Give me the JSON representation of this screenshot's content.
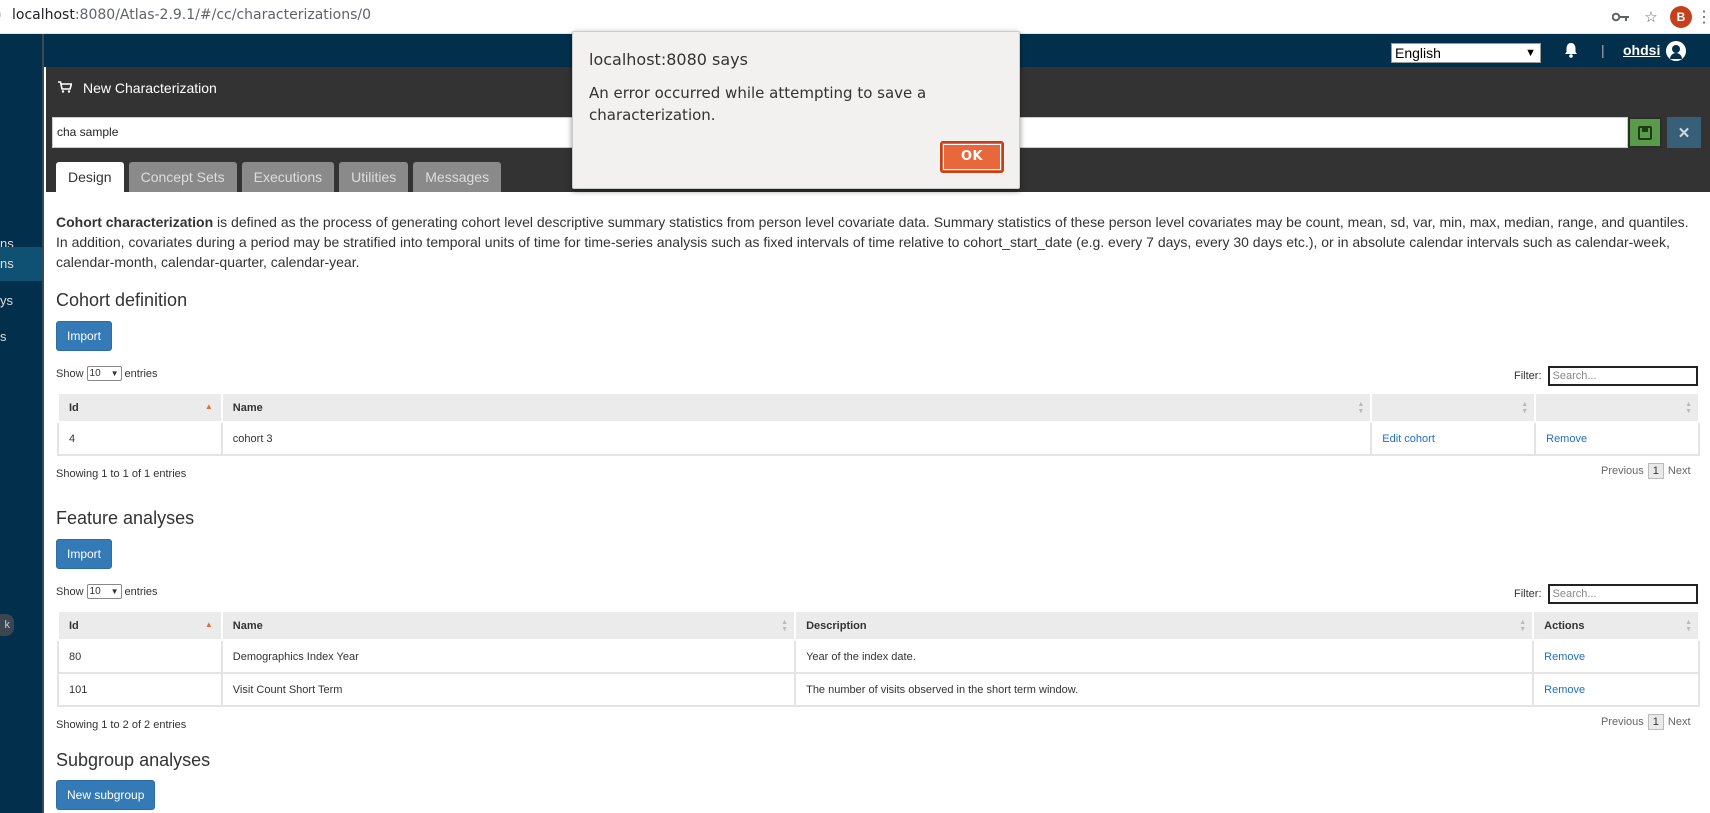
{
  "browser": {
    "url_host": "localhost",
    "url_rest": ":8080/Atlas-2.9.1/#/cc/characterizations/0",
    "profile_initial": "B",
    "icons": [
      "key-icon",
      "star-icon",
      "kebab-menu-icon"
    ]
  },
  "sidebar": {
    "items": [
      {
        "label": "ns",
        "active": false
      },
      {
        "label": "ns",
        "active": true
      },
      {
        "label": "ys",
        "active": false
      },
      {
        "label": "s",
        "active": false
      }
    ],
    "pill": "k"
  },
  "topbar": {
    "language": "English",
    "separator": "|",
    "user": "ohdsi"
  },
  "panel": {
    "title": "New Characterization",
    "name_value": "cha sample",
    "tabs": [
      "Design",
      "Concept Sets",
      "Executions",
      "Utilities",
      "Messages"
    ]
  },
  "description": {
    "bold": "Cohort characterization",
    "rest": " is defined as the process of generating cohort level descriptive summary statistics from person level covariate data. Summary statistics of these person level covariates may be count, mean, sd, var, min, max, median, range, and quantiles. In addition, covariates during a period may be stratified into temporal units of time for time-series analysis such as fixed intervals of time relative to cohort_start_date (e.g. every 7 days, every 30 days etc.), or in absolute calendar intervals such as calendar-week, calendar-month, calendar-quarter, calendar-year."
  },
  "cohort_section": {
    "title": "Cohort definition",
    "import_label": "Import",
    "show_label": "Show",
    "entries_value": "10",
    "entries_label": "entries",
    "filter_label": "Filter:",
    "filter_placeholder": "Search...",
    "columns": [
      "Id",
      "Name",
      "",
      ""
    ],
    "rows": [
      {
        "id": "4",
        "name": "cohort 3",
        "edit": "Edit cohort",
        "remove": "Remove"
      }
    ],
    "showing": "Showing 1 to 1 of 1 entries",
    "prev": "Previous",
    "page": "1",
    "next": "Next"
  },
  "feature_section": {
    "title": "Feature analyses",
    "import_label": "Import",
    "show_label": "Show",
    "entries_value": "10",
    "entries_label": "entries",
    "filter_label": "Filter:",
    "filter_placeholder": "Search...",
    "columns": [
      "Id",
      "Name",
      "Description",
      "Actions"
    ],
    "rows": [
      {
        "id": "80",
        "name": "Demographics Index Year",
        "description": "Year of the index date.",
        "action": "Remove"
      },
      {
        "id": "101",
        "name": "Visit Count Short Term",
        "description": "The number of visits observed in the short term window.",
        "action": "Remove"
      }
    ],
    "showing": "Showing 1 to 2 of 2 entries",
    "prev": "Previous",
    "page": "1",
    "next": "Next"
  },
  "subgroup_section": {
    "title": "Subgroup analyses",
    "new_label": "New subgroup"
  },
  "dialog": {
    "title": "localhost:8080 says",
    "message": "An error occurred while attempting to save a characterization.",
    "ok": "OK"
  },
  "colors": {
    "navy": "#02304c",
    "panel": "#333333",
    "primary": "#337ab7",
    "ok_button": "#e8683c",
    "save_button": "#5a9a4b"
  }
}
